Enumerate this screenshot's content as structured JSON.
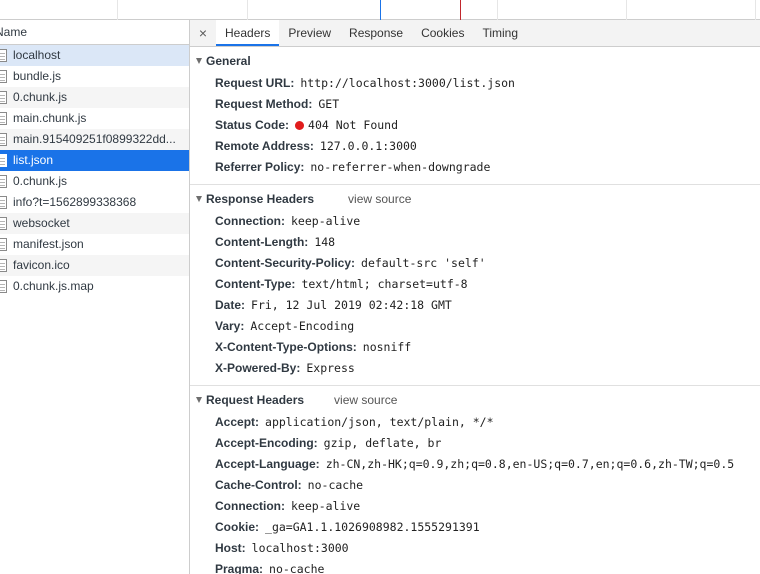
{
  "colors": {
    "selected_row": "#1a73e8",
    "status_error": "#e11d1d",
    "timeline_blue": "#1a73e8",
    "timeline_red": "#c1272d"
  },
  "list": {
    "header": "Name",
    "items": [
      {
        "name": "localhost",
        "state": "highlight"
      },
      {
        "name": "bundle.js",
        "state": "normal"
      },
      {
        "name": "0.chunk.js",
        "state": "alt"
      },
      {
        "name": "main.chunk.js",
        "state": "normal"
      },
      {
        "name": "main.915409251f0899322dd...",
        "state": "alt"
      },
      {
        "name": "list.json",
        "state": "selected"
      },
      {
        "name": "0.chunk.js",
        "state": "normal"
      },
      {
        "name": "info?t=1562899338368",
        "state": "normal"
      },
      {
        "name": "websocket",
        "state": "alt"
      },
      {
        "name": "manifest.json",
        "state": "normal"
      },
      {
        "name": "favicon.ico",
        "state": "alt"
      },
      {
        "name": "0.chunk.js.map",
        "state": "normal"
      }
    ]
  },
  "tabs": {
    "close": "×",
    "items": [
      "Headers",
      "Preview",
      "Response",
      "Cookies",
      "Timing"
    ],
    "active": "Headers"
  },
  "general": {
    "title": "General",
    "request_url_label": "Request URL:",
    "request_url": "http://localhost:3000/list.json",
    "request_method_label": "Request Method:",
    "request_method": "GET",
    "status_code_label": "Status Code:",
    "status_code": "404 Not Found",
    "remote_address_label": "Remote Address:",
    "remote_address": "127.0.0.1:3000",
    "referrer_policy_label": "Referrer Policy:",
    "referrer_policy": "no-referrer-when-downgrade"
  },
  "response_headers": {
    "title": "Response Headers",
    "view_source": "view source",
    "items": [
      {
        "key": "Connection:",
        "value": "keep-alive"
      },
      {
        "key": "Content-Length:",
        "value": "148"
      },
      {
        "key": "Content-Security-Policy:",
        "value": "default-src 'self'"
      },
      {
        "key": "Content-Type:",
        "value": "text/html; charset=utf-8"
      },
      {
        "key": "Date:",
        "value": "Fri, 12 Jul 2019 02:42:18 GMT"
      },
      {
        "key": "Vary:",
        "value": "Accept-Encoding"
      },
      {
        "key": "X-Content-Type-Options:",
        "value": "nosniff"
      },
      {
        "key": "X-Powered-By:",
        "value": "Express"
      }
    ]
  },
  "request_headers": {
    "title": "Request Headers",
    "view_source": "view source",
    "items": [
      {
        "key": "Accept:",
        "value": "application/json, text/plain, */*"
      },
      {
        "key": "Accept-Encoding:",
        "value": "gzip, deflate, br"
      },
      {
        "key": "Accept-Language:",
        "value": "zh-CN,zh-HK;q=0.9,zh;q=0.8,en-US;q=0.7,en;q=0.6,zh-TW;q=0.5"
      },
      {
        "key": "Cache-Control:",
        "value": "no-cache"
      },
      {
        "key": "Connection:",
        "value": "keep-alive"
      },
      {
        "key": "Cookie:",
        "value": "_ga=GA1.1.1026908982.1555291391"
      },
      {
        "key": "Host:",
        "value": "localhost:3000"
      },
      {
        "key": "Pragma:",
        "value": "no-cache"
      }
    ]
  }
}
